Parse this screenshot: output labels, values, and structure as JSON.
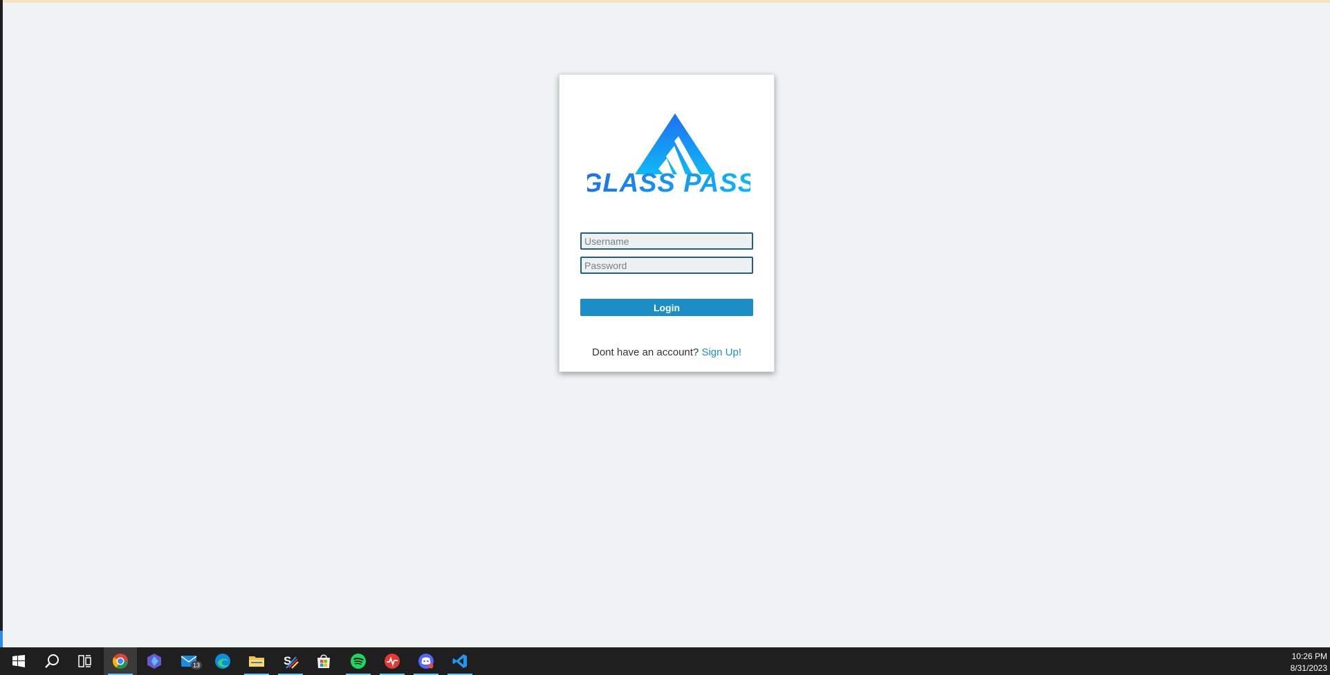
{
  "login": {
    "logo_text": "GLASS PASS",
    "username_placeholder": "Username",
    "password_placeholder": "Password",
    "login_label": "Login",
    "signup_prompt": "Dont have an account?",
    "signup_link": "Sign Up!"
  },
  "colors": {
    "accent": "#1a8ec5",
    "logo_gradient_top": "#1e6ff0",
    "logo_gradient_bottom": "#10b8f6",
    "page_background": "#eff3f4"
  },
  "taskbar": {
    "apps": [
      {
        "name": "start-icon"
      },
      {
        "name": "search-icon"
      },
      {
        "name": "task-view-icon"
      },
      {
        "name": "chrome-icon",
        "active": true
      },
      {
        "name": "copilot-icon"
      },
      {
        "name": "mail-icon",
        "badge": "13"
      },
      {
        "name": "edge-icon"
      },
      {
        "name": "file-explorer-icon",
        "running": true
      },
      {
        "name": "app-s-icon",
        "running": true
      },
      {
        "name": "store-icon"
      },
      {
        "name": "spotify-icon",
        "running": true
      },
      {
        "name": "activity-app-icon",
        "running": true
      },
      {
        "name": "discord-icon",
        "running": true
      },
      {
        "name": "vscode-icon",
        "running": true
      }
    ],
    "time": "10:26 PM",
    "date": "8/31/2023"
  }
}
